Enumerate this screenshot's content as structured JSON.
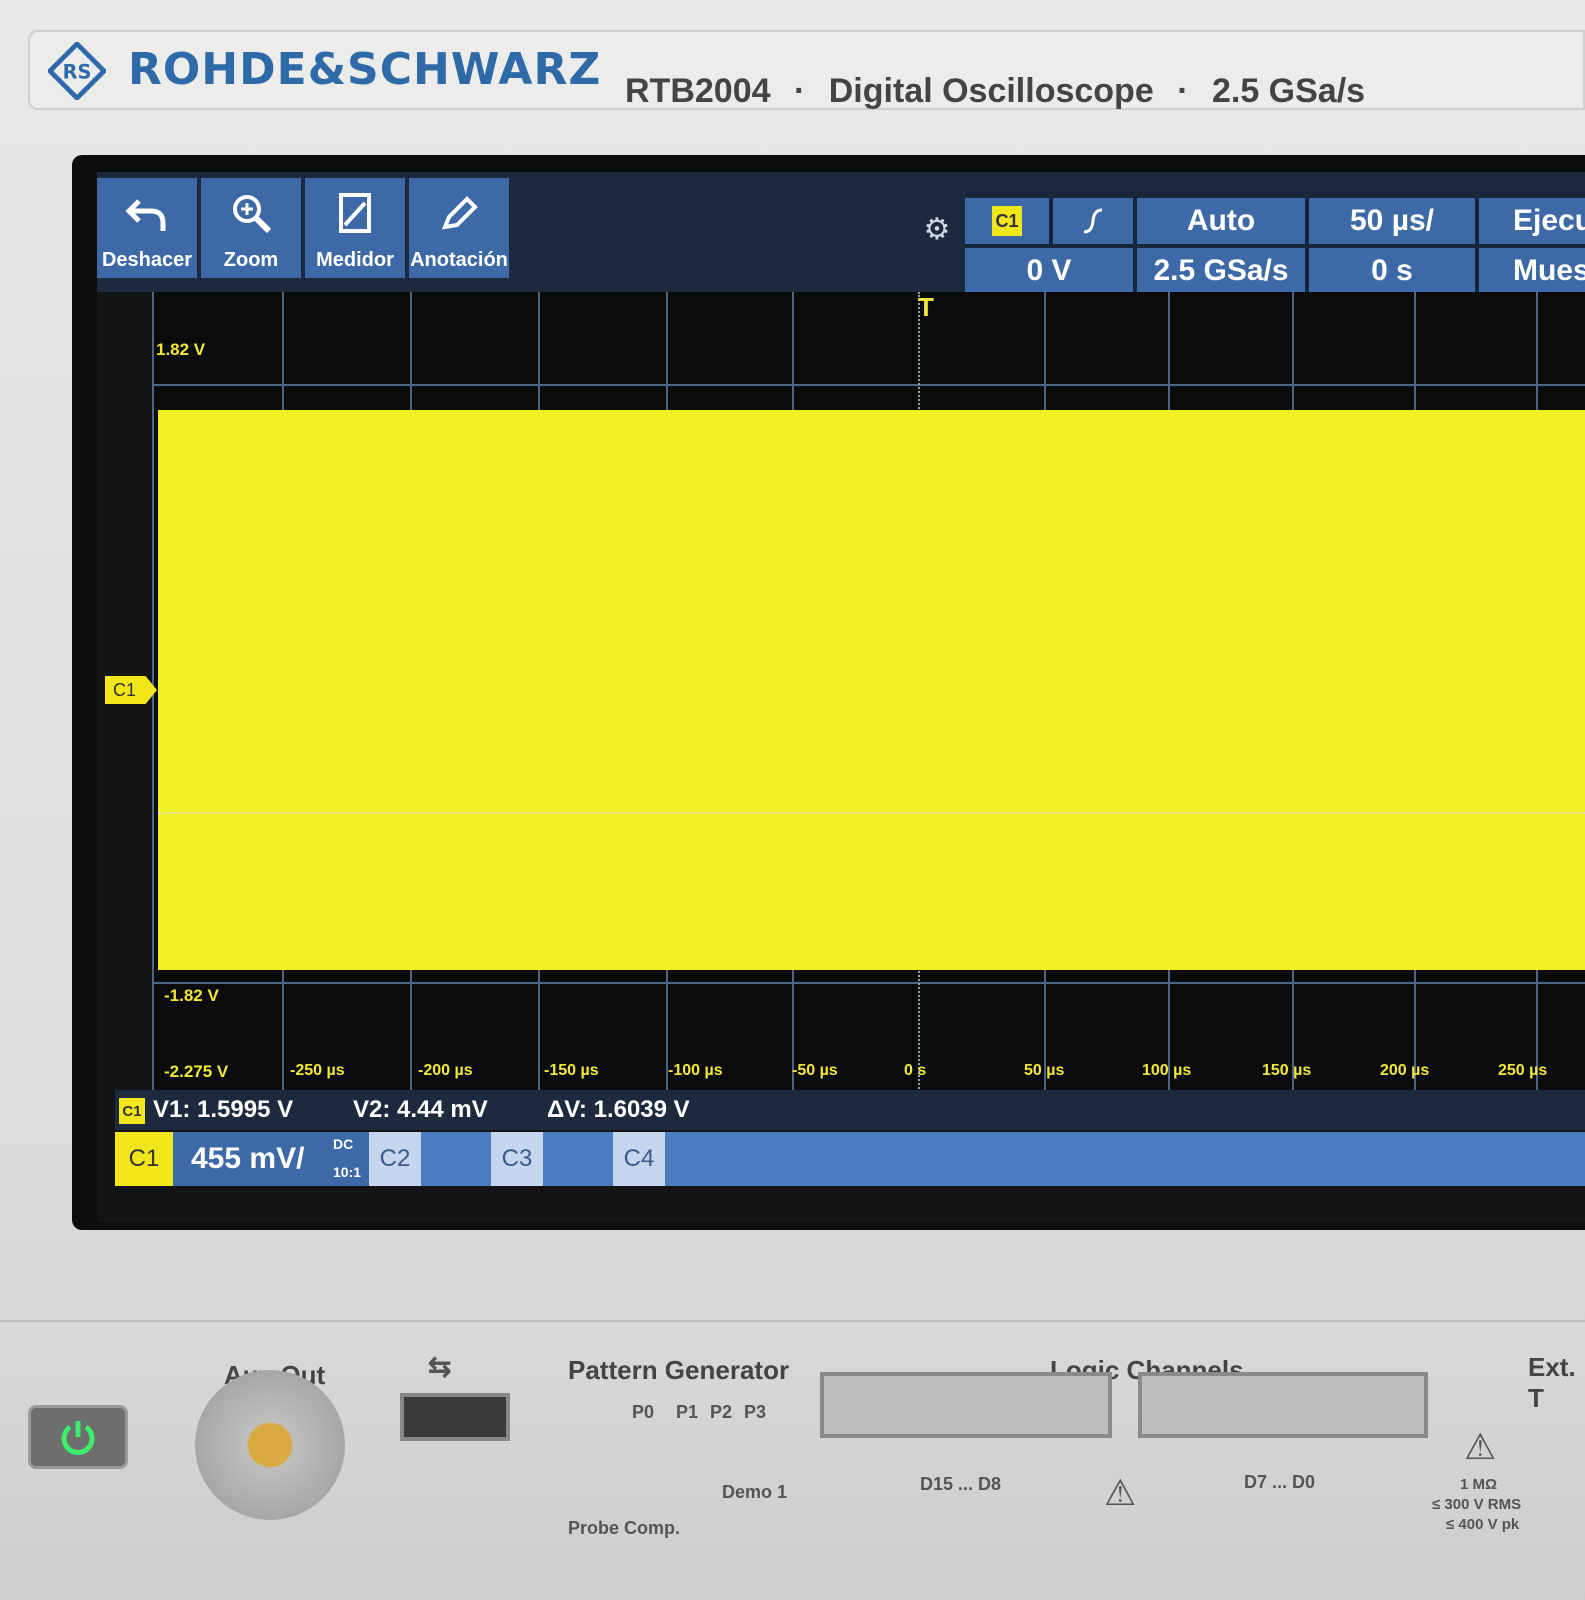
{
  "header": {
    "brand": "ROHDE&SCHWARZ",
    "model": "RTB2004",
    "description": "Digital Oscilloscope",
    "sample_rate": "2.5 GSa/s",
    "separator": "·"
  },
  "toolbar": {
    "undo": "Deshacer",
    "zoom": "Zoom",
    "meter": "Medidor",
    "annotation": "Anotación"
  },
  "params": {
    "trigger_source": "C1",
    "trigger_level": "0 V",
    "trigger_mode": "Auto",
    "sample_rate": "2.5 GSa/s",
    "timebase": "50 µs/",
    "time_offset": "0 s",
    "run_label": "Ejecu",
    "acq_label": "Mues"
  },
  "plot": {
    "y_labels": [
      "1.82 V",
      "-1.82 V",
      "-2.275 V"
    ],
    "x_labels": [
      "-250 µs",
      "-200 µs",
      "-150 µs",
      "-100 µs",
      "-50 µs",
      "0 s",
      "50 µs",
      "100 µs",
      "150 µs",
      "200 µs",
      "250 µs"
    ],
    "channel_marker": "C1",
    "trigger_marker": "T",
    "trace_color": "#f1f024"
  },
  "cursors": {
    "channel": "C1",
    "v1": "V1: 1.5995 V",
    "v2": "V2: 4.44 mV",
    "dv": "ΔV: 1.6039 V"
  },
  "channels": {
    "c1": "C1",
    "c1_scale": "455 mV/",
    "c1_coupling": "DC",
    "c1_probe": "10:1",
    "c2": "C2",
    "c3": "C3",
    "c4": "C4"
  },
  "front_panel": {
    "aux_out": "Aux Out",
    "pattern_generator": "Pattern Generator",
    "p0": "P0",
    "p1": "P1",
    "p2": "P2",
    "p3": "P3",
    "probe_comp": "Probe Comp.",
    "demo": "Demo 1",
    "logic_channels": "Logic Channels",
    "d15_d8": "D15 ... D8",
    "d7_d0": "D7 ... D0",
    "ext_trig": "Ext. T",
    "input_imp": "1 MΩ",
    "max_rms": "≤ 300 V RMS",
    "max_pk": "≤ 400 V pk"
  }
}
